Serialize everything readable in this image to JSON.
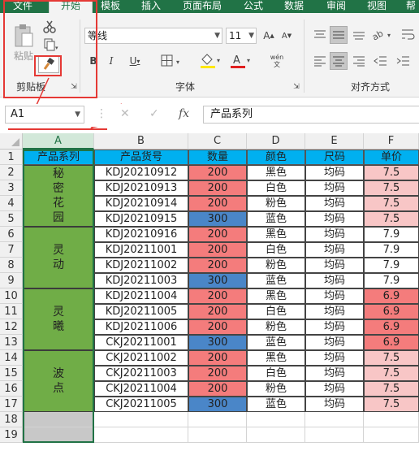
{
  "ribbon_tabs": [
    "文件",
    "开始",
    "模板",
    "插入",
    "页面布局",
    "公式",
    "数据",
    "审阅",
    "视图",
    "帮"
  ],
  "clipboard": {
    "paste_label": "粘贴",
    "group_label": "剪贴板"
  },
  "font": {
    "name": "等线",
    "size": "11",
    "group_label": "字体",
    "wen": "wén\n文"
  },
  "alignment": {
    "group_label": "对齐方式"
  },
  "formula_bar": {
    "name_box": "A1",
    "content": "产品系列",
    "fx": "fx"
  },
  "columns": [
    "A",
    "B",
    "C",
    "D",
    "E",
    "F"
  ],
  "rows": [
    "1",
    "2",
    "3",
    "4",
    "5",
    "6",
    "7",
    "8",
    "9",
    "10",
    "11",
    "12",
    "13",
    "14",
    "15",
    "16",
    "17",
    "18",
    "19"
  ],
  "headers": [
    "产品系列",
    "产品货号",
    "数量",
    "颜色",
    "尺码",
    "单价"
  ],
  "series_groups": [
    {
      "name": "秘\n密\n花\n园"
    },
    {
      "name": "灵\n动"
    },
    {
      "name": "灵\n曦"
    },
    {
      "name": "波\n点"
    }
  ],
  "data_rows": [
    [
      "KDJ20210912",
      "200",
      "黑色",
      "均码",
      "7.5"
    ],
    [
      "KDJ20210913",
      "200",
      "白色",
      "均码",
      "7.5"
    ],
    [
      "KDJ20210914",
      "200",
      "粉色",
      "均码",
      "7.5"
    ],
    [
      "KDJ20210915",
      "300",
      "蓝色",
      "均码",
      "7.5"
    ],
    [
      "KDJ20210916",
      "200",
      "黑色",
      "均码",
      "7.9"
    ],
    [
      "KDJ20211001",
      "200",
      "白色",
      "均码",
      "7.9"
    ],
    [
      "KDJ20211002",
      "200",
      "粉色",
      "均码",
      "7.9"
    ],
    [
      "KDJ20211003",
      "300",
      "蓝色",
      "均码",
      "7.9"
    ],
    [
      "KDJ20211004",
      "200",
      "黑色",
      "均码",
      "6.9"
    ],
    [
      "KDJ20211005",
      "200",
      "白色",
      "均码",
      "6.9"
    ],
    [
      "KDJ20211006",
      "200",
      "粉色",
      "均码",
      "6.9"
    ],
    [
      "CKJ20211001",
      "300",
      "蓝色",
      "均码",
      "6.9"
    ],
    [
      "CKJ20211002",
      "200",
      "黑色",
      "均码",
      "7.5"
    ],
    [
      "CKJ20211003",
      "200",
      "白色",
      "均码",
      "7.5"
    ],
    [
      "CKJ20211004",
      "200",
      "粉色",
      "均码",
      "7.5"
    ],
    [
      "CKJ20211005",
      "300",
      "蓝色",
      "均码",
      "7.5"
    ]
  ],
  "colors": {
    "header": "#00b0f0",
    "series": "#70ad47",
    "qty200": "#f47c7c",
    "qty300": "#4a86c8",
    "price_75": "#f8c6c6",
    "price_79": "#ffffff",
    "price_69": "#f47c7c",
    "accent": "#217346",
    "annotation": "#e53935"
  }
}
